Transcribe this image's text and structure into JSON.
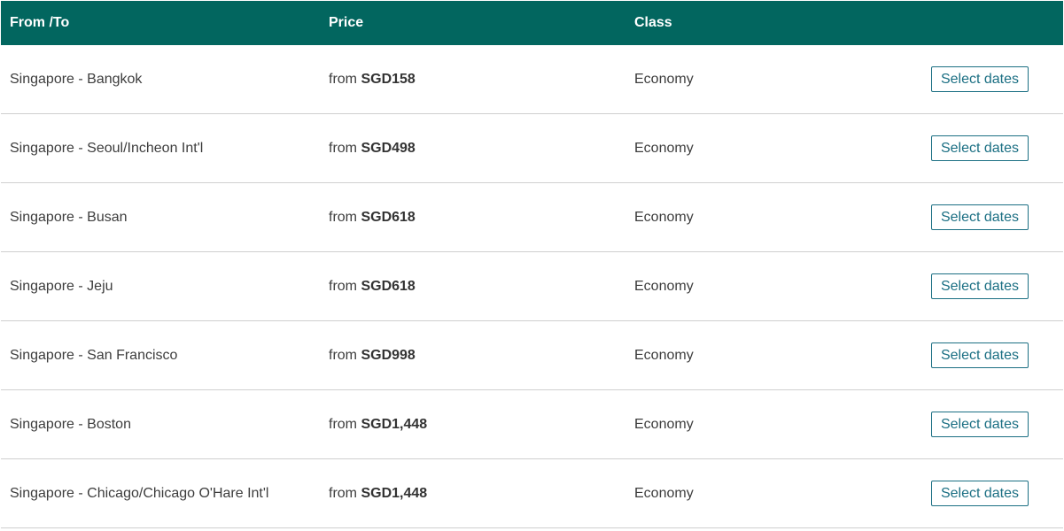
{
  "header": {
    "from_to": "From /To",
    "price": "Price",
    "class": "Class"
  },
  "colors": {
    "header_bg": "#02665f",
    "button_accent": "#1b6f83"
  },
  "rows": [
    {
      "route": "Singapore - Bangkok",
      "price_prefix": "from ",
      "price": "SGD158",
      "class": "Economy",
      "button": "Select dates"
    },
    {
      "route": "Singapore - Seoul/Incheon Int'l",
      "price_prefix": "from ",
      "price": "SGD498",
      "class": "Economy",
      "button": "Select dates"
    },
    {
      "route": "Singapore - Busan",
      "price_prefix": "from ",
      "price": "SGD618",
      "class": "Economy",
      "button": "Select dates"
    },
    {
      "route": "Singapore - Jeju",
      "price_prefix": "from ",
      "price": "SGD618",
      "class": "Economy",
      "button": "Select dates"
    },
    {
      "route": "Singapore - San Francisco",
      "price_prefix": "from ",
      "price": "SGD998",
      "class": "Economy",
      "button": "Select dates"
    },
    {
      "route": "Singapore - Boston",
      "price_prefix": "from ",
      "price": "SGD1,448",
      "class": "Economy",
      "button": "Select dates"
    },
    {
      "route": "Singapore - Chicago/Chicago O'Hare Int'l",
      "price_prefix": "from ",
      "price": "SGD1,448",
      "class": "Economy",
      "button": "Select dates"
    }
  ]
}
